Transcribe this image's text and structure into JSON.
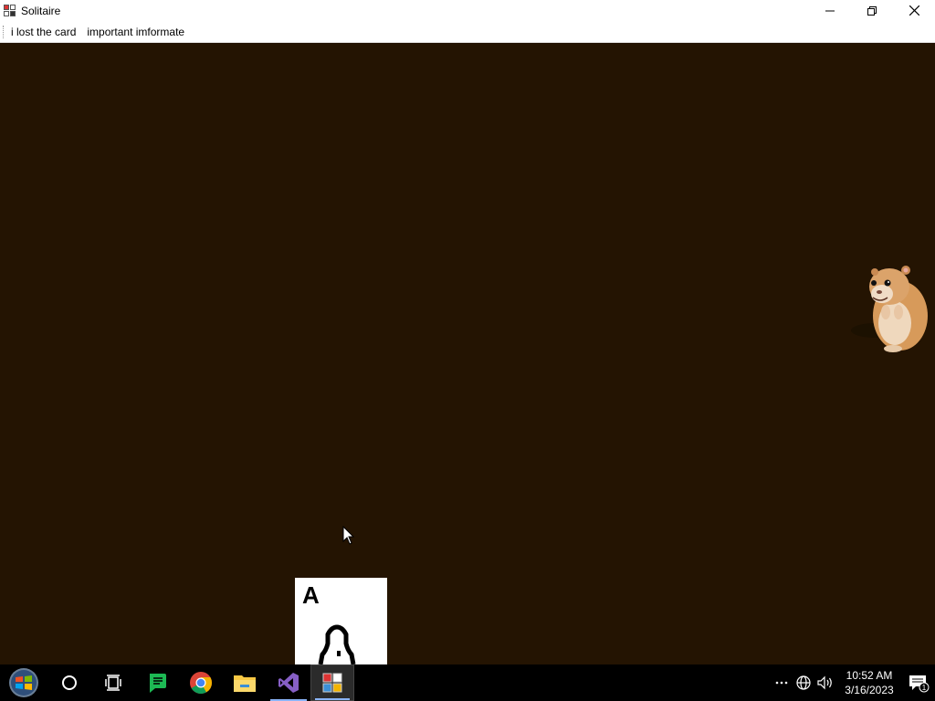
{
  "window": {
    "title": "Solitaire",
    "background": "#241402"
  },
  "menu": {
    "items": [
      "i lost the card",
      "important imformate"
    ]
  },
  "card": {
    "rank": "A"
  },
  "taskbar": {
    "apps": [
      {
        "name": "start-icon"
      },
      {
        "name": "cortana-search-icon"
      },
      {
        "name": "task-view-icon"
      },
      {
        "name": "notes-app-icon"
      },
      {
        "name": "chrome-icon"
      },
      {
        "name": "file-explorer-icon"
      },
      {
        "name": "visual-studio-icon"
      },
      {
        "name": "solitaire-app-icon"
      }
    ],
    "clock_time": "10:52 AM",
    "clock_date": "3/16/2023",
    "notification_count": "1"
  }
}
